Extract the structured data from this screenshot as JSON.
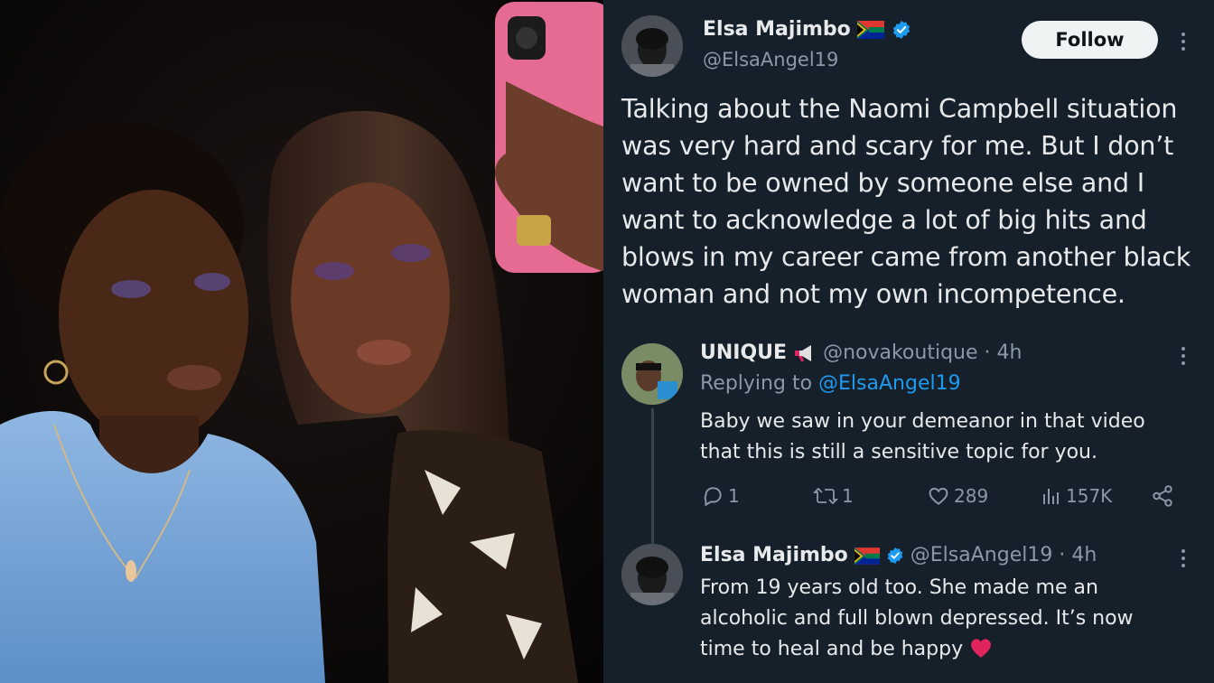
{
  "photo": {
    "description_icon": "photo"
  },
  "tweet": {
    "author_name": "Elsa Majimbo",
    "author_flag": "south-africa-flag-icon",
    "author_handle": "@ElsaAngel19",
    "follow_label": "Follow",
    "text": "Talking about the Naomi Campbell situation was very hard and scary for me. But I don’t want to be owned by someone else and I want to acknowledge a lot of big hits and blows in my career came from another black woman and not my own incompetence."
  },
  "reply1": {
    "author_name": "UNIQUE",
    "author_emoji": "megaphone-icon",
    "author_handle": "@novakoutique",
    "time": "· 4h",
    "replying_prefix": "Replying to",
    "replying_handle": "@ElsaAngel19",
    "text": "Baby we saw in your demeanor in that video that this is still a sensitive topic for you.",
    "stats": {
      "replies": "1",
      "retweets": "1",
      "likes": "289",
      "views": "157K"
    }
  },
  "reply2": {
    "author_name": "Elsa Majimbo",
    "author_handle": "@ElsaAngel19",
    "time": "· 4h",
    "text": "From 19 years old too. She made me an alcoholic and full blown depressed. It’s now time to heal and be happy",
    "emoji": "red-heart-icon"
  },
  "colors": {
    "background": "#15202b",
    "text": "#e7e9ea",
    "muted": "#8b98a5",
    "link": "#1d9bf0",
    "verified": "#1d9bf0",
    "heart": "#e0245e"
  }
}
